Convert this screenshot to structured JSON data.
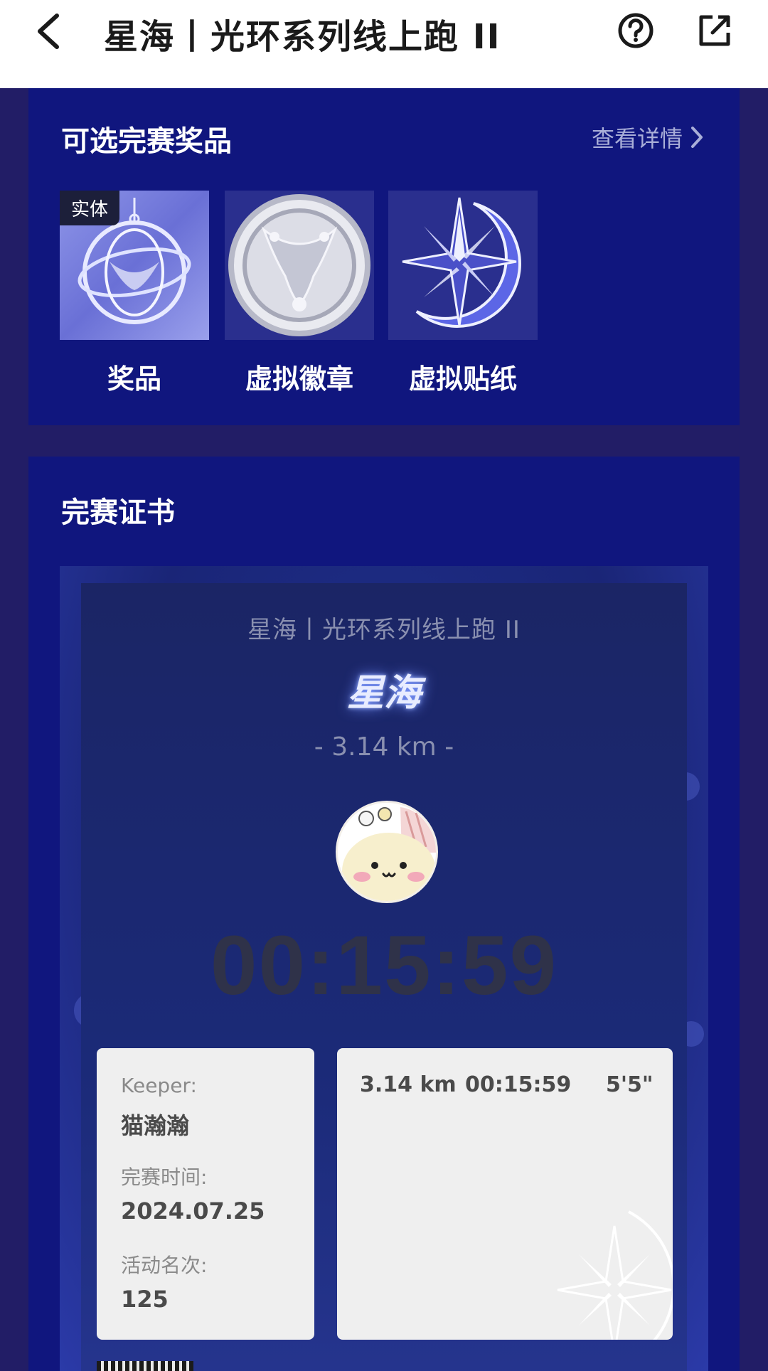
{
  "header": {
    "title": "星海丨光环系列线上跑 II",
    "back_icon": "chevron-left-icon",
    "help_icon": "question-circle-icon",
    "share_icon": "external-share-icon"
  },
  "prizes": {
    "title": "可选完赛奖品",
    "details_link": "查看详情",
    "items": [
      {
        "label": "奖品",
        "tag": "实体",
        "icon": "medal-pendant"
      },
      {
        "label": "虚拟徽章",
        "icon": "silver-badge"
      },
      {
        "label": "虚拟贴纸",
        "icon": "star-moon-sticker"
      }
    ]
  },
  "certificate": {
    "title": "完赛证书",
    "event_name": "星海丨光环系列线上跑 II",
    "logo_text": "星海",
    "distance": "- 3.14 km -",
    "time": "00:15:59",
    "keeper_label": "Keeper:",
    "keeper_name": "猫瀚瀚",
    "finish_time_label": "完赛时间:",
    "finish_time": "2024.07.25",
    "rank_label": "活动名次:",
    "rank": "125",
    "stats": {
      "distance": "3.14 km",
      "duration": "00:15:59",
      "pace": "5'5\""
    }
  },
  "colors": {
    "page_bg": "#221d66",
    "card_bg": "#10167e",
    "header_bg": "#ffffff"
  }
}
